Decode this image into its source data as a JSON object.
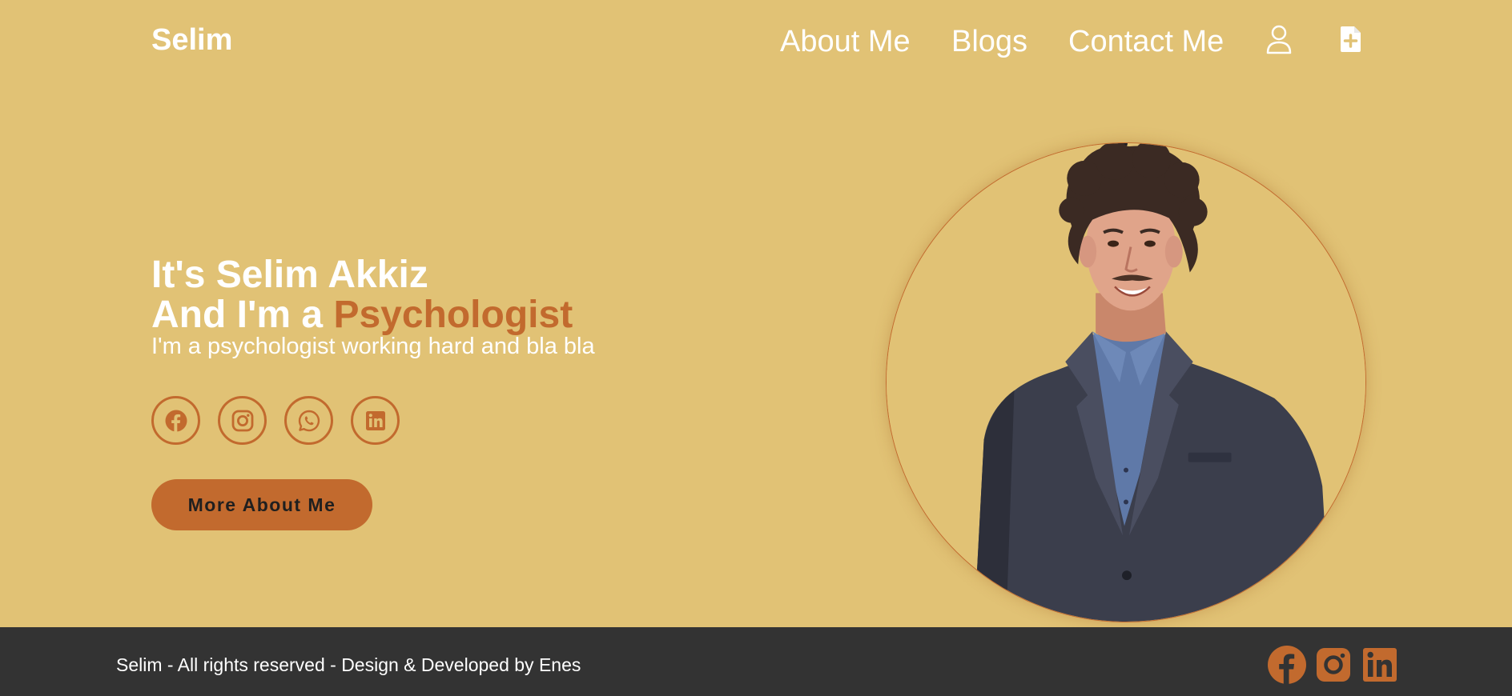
{
  "header": {
    "logo": "Selim",
    "nav": {
      "about": "About Me",
      "blogs": "Blogs",
      "contact": "Contact Me"
    },
    "icons": [
      "user-icon",
      "file-plus-icon"
    ]
  },
  "hero": {
    "line1": "It's Selim Akkiz",
    "line2_prefix": "And I'm a ",
    "line2_accent": "Psychologist",
    "subtitle": "I'm a psychologist working hard and bla bla",
    "socials": [
      "facebook-icon",
      "instagram-icon",
      "whatsapp-icon",
      "linkedin-icon"
    ],
    "cta_label": "More About Me"
  },
  "footer": {
    "text": "Selim - All rights reserved - Design & Developed by Enes",
    "icons": [
      "facebook-icon",
      "instagram-icon",
      "linkedin-icon"
    ]
  },
  "colors": {
    "background": "#e1c275",
    "accent": "#c26a2e",
    "footer_bg": "#333333",
    "text_light": "#ffffff"
  }
}
